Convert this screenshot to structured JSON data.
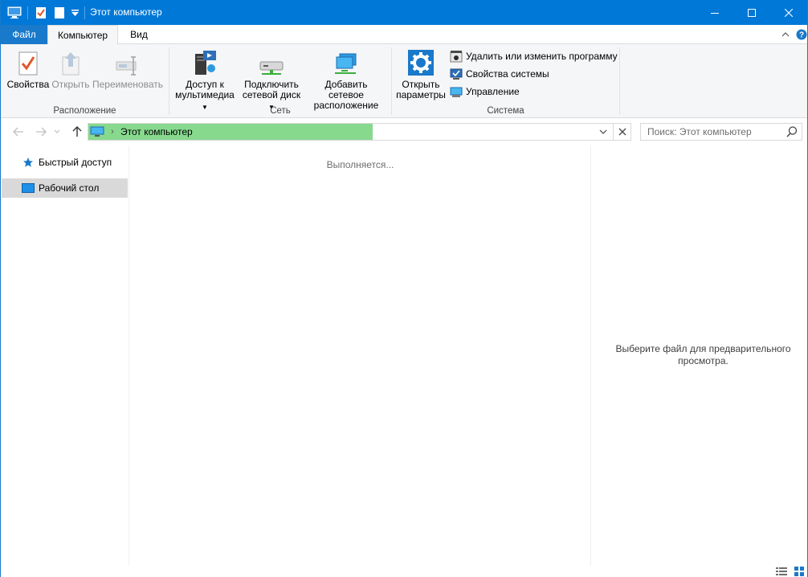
{
  "window": {
    "title": "Этот компьютер"
  },
  "ribbon_tabs": {
    "file": "Файл",
    "computer": "Компьютер",
    "view": "Вид"
  },
  "ribbon": {
    "location": {
      "label": "Расположение",
      "properties": "Свойства",
      "open": "Открыть",
      "rename": "Переименовать"
    },
    "network": {
      "label": "Сеть",
      "media_line1": "Доступ к",
      "media_line2": "мультимедиа",
      "map_line1": "Подключить",
      "map_line2": "сетевой диск",
      "addnet_line1": "Добавить сетевое",
      "addnet_line2": "расположение"
    },
    "system": {
      "label": "Система",
      "settings_line1": "Открыть",
      "settings_line2": "параметры",
      "uninstall": "Удалить или изменить программу",
      "sysprops": "Свойства системы",
      "manage": "Управление"
    }
  },
  "address": {
    "path": "Этот компьютер",
    "search_placeholder": "Поиск: Этот компьютер"
  },
  "nav": {
    "items": [
      {
        "label": "Быстрый доступ",
        "icon": "star-icon"
      },
      {
        "label": "Рабочий стол",
        "icon": "desktop-icon"
      }
    ]
  },
  "content": {
    "loading": "Выполняется..."
  },
  "preview": {
    "message_line1": "Выберите файл для предварительного",
    "message_line2": "просмотра."
  },
  "colors": {
    "titlebar": "#0078d7",
    "file_tab": "#1979ca",
    "progress": "#87d98e",
    "selection": "#d9d9d9"
  }
}
